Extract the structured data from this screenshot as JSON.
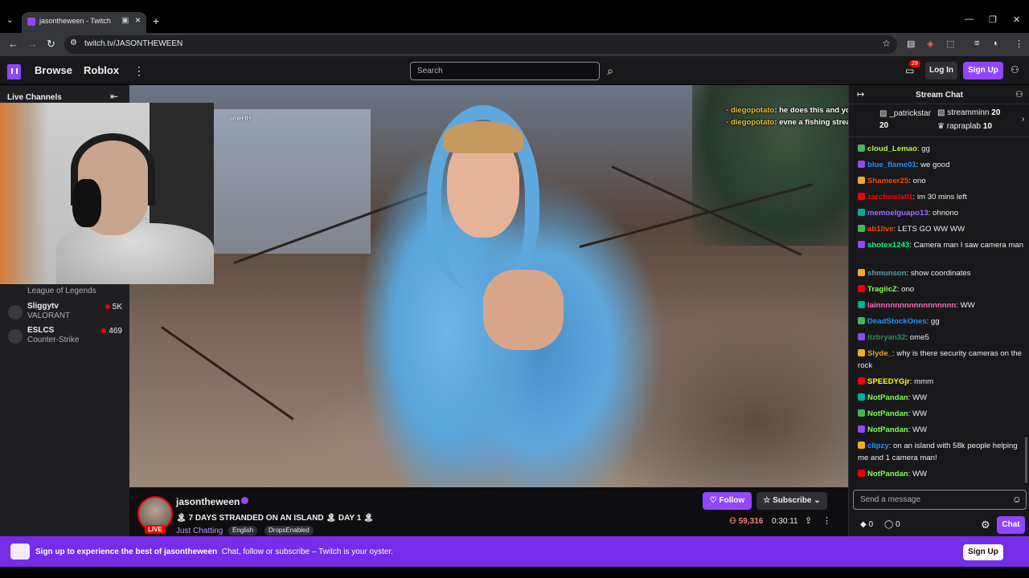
{
  "browser": {
    "tab_title": "jasontheween - Twitch",
    "url": "twitch.tv/JASONTHEWEEN",
    "minimize": "—",
    "maximize": "❐",
    "close": "✕"
  },
  "nav": {
    "browse": "Browse",
    "roblox": "Roblox",
    "search_placeholder": "Search",
    "notif_count": "29",
    "login": "Log In",
    "signup": "Sign Up"
  },
  "sidebar": {
    "title": "Live Channels",
    "channels": [
      {
        "name": "",
        "game": "League of Legends",
        "viewers": ""
      },
      {
        "name": "Sliggytv",
        "game": "VALORANT",
        "viewers": "5K"
      },
      {
        "name": "ESLCS",
        "game": "Counter-Strike",
        "viewers": "469"
      }
    ]
  },
  "overlay": {
    "lines": [
      {
        "name": "diegopotato",
        "text": ": he does this and you wont even do a camping stream"
      },
      {
        "name": "diegopotato",
        "text": ": evne a fishing stream"
      }
    ],
    "cam_label": "omeHH"
  },
  "stream": {
    "streamer": "jasontheween",
    "title": "🏝 7 DAYS STRANDED ON AN ISLAND 🏝 DAY 1 🏝",
    "category": "Just Chatting",
    "tags": [
      "English",
      "DropsEnabled"
    ],
    "live": "LIVE",
    "follow": "Follow",
    "subscribe": "Subscribe",
    "viewers": "59,316",
    "uptime": "0:30:11"
  },
  "chat": {
    "title": "Stream Chat",
    "gifts": [
      {
        "name": "_patrickstar",
        "count": "20"
      },
      {
        "name": "streamminn",
        "count": "20"
      },
      {
        "name": "rapraplab",
        "count": "10"
      }
    ],
    "messages": [
      {
        "user": "cloud_Lemao",
        "color": "#b8f24d",
        "text": ": gg"
      },
      {
        "user": "blue_flame01",
        "color": "#1e90ff",
        "text": ": we good"
      },
      {
        "user": "Shameer25",
        "color": "#ff4500",
        "text": ": ono"
      },
      {
        "user": "zarchwela01",
        "color": "#ff0000",
        "text": ": im 30 mins left"
      },
      {
        "user": "memoelguapo13",
        "color": "#9b6bff",
        "text": ": ohnono"
      },
      {
        "user": "ab1live",
        "color": "#ff4500",
        "text": ": LETS GO WW WW"
      },
      {
        "user": "shotex1243",
        "color": "#00ff7f",
        "text": ": Camera man I saw camera man"
      },
      {
        "user": "shmunson",
        "color": "#5f9ea0",
        "text": ": show coordinates"
      },
      {
        "user": "TragiicZ",
        "color": "#7cff4f",
        "text": ": ono"
      },
      {
        "user": "lainnnnnnnnnnnnnnnnn",
        "color": "#ff69b4",
        "text": ": WW"
      },
      {
        "user": "DeadStockOnes",
        "color": "#1e90ff",
        "text": ": gg"
      },
      {
        "user": "itzbryan32",
        "color": "#2e8b57",
        "text": ": ome5"
      },
      {
        "user": "Slyde_",
        "color": "#daa520",
        "text": ": why is there security cameras on the rock"
      },
      {
        "user": "SPEEDYGjr",
        "color": "#ffff00",
        "text": ": mmm"
      },
      {
        "user": "NotPandan",
        "color": "#7cff4f",
        "text": ": WW"
      },
      {
        "user": "NotPandan",
        "color": "#7cff4f",
        "text": ": WW"
      },
      {
        "user": "NotPandan",
        "color": "#7cff4f",
        "text": ": WW"
      },
      {
        "user": "clipzy",
        "color": "#1e90ff",
        "text": ": on an island with 58k people helping me and 1 camera man!"
      },
      {
        "user": "NotPandan",
        "color": "#7cff4f",
        "text": ": WW"
      }
    ],
    "input_placeholder": "Send a message",
    "points_a": "0",
    "points_b": "0",
    "chat_button": "Chat"
  },
  "banner": {
    "lead": "Sign up to experience the best of jasontheween",
    "rest": "Chat, follow or subscribe – Twitch is your oyster.",
    "signup": "Sign Up"
  },
  "colors": {
    "brand": "#9146ff",
    "live": "#eb0400",
    "banner": "#772ce8"
  }
}
